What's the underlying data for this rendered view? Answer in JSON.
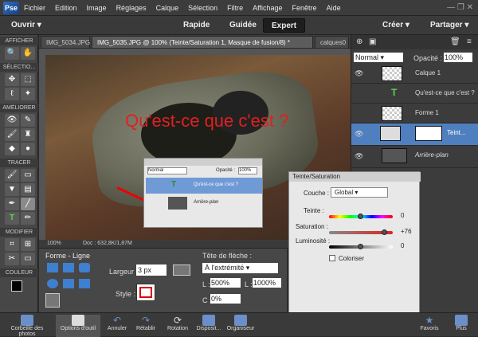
{
  "menubar": {
    "logo": "Pse",
    "items": [
      "Fichier",
      "Edition",
      "Image",
      "Réglages",
      "Calque",
      "Sélection",
      "Filtre",
      "Affichage",
      "Fenêtre",
      "Aide"
    ]
  },
  "modebar": {
    "open": "Ouvrir",
    "rapide": "Rapide",
    "guidee": "Guidée",
    "expert": "Expert",
    "creer": "Créer",
    "partager": "Partager"
  },
  "tools": {
    "afficher": "AFFICHER",
    "selection": "SÉLECTIO...",
    "ameliorer": "AMÉLIORER",
    "tracer": "TRACER",
    "modifier": "MODIFIER",
    "couleur": "COULEUR"
  },
  "tabs": [
    "IMG_5034.JPG",
    "IMG_5035.JPG @ 100% (Teinte/Saturation 1, Masque de fusion/8) *",
    "calques0"
  ],
  "canvas": {
    "bigtext": "Qu'est-ce que c'est ?"
  },
  "status": {
    "zoom": "100%",
    "doc": "Doc : 632,8K/1,87M"
  },
  "options": {
    "title": "Forme - Ligne",
    "largeur_label": "Largeur :",
    "largeur": "3 px",
    "style_label": "Style :",
    "tete_label": "Tête de flèche :",
    "tete": "À l'extrémité",
    "l_label": "L :",
    "l1": "500%",
    "l2_label": "L :",
    "l2": "1000%",
    "c_label": "C :",
    "c": "0%"
  },
  "bottom": [
    "Corbeille des photos",
    "Options d'outil",
    "Annuler",
    "Rétablir",
    "Rotation",
    "Disposit...",
    "Organiseur",
    "Favoris",
    "Plus"
  ],
  "layers": {
    "mode": "Normal",
    "opacity_label": "Opacité :",
    "opacity": "100%",
    "items": [
      {
        "name": "Calque 1"
      },
      {
        "name": "Qu'est-ce que c'est ?"
      },
      {
        "name": "Forme 1"
      },
      {
        "name": "Teint..."
      },
      {
        "name": "Arrière-plan"
      }
    ]
  },
  "mini": {
    "mode": "Normal",
    "opacity_label": "Opacité :",
    "opacity": "100%",
    "l1": "Qu'est-ce que c'est ?",
    "l2": "Arrière-plan"
  },
  "hs": {
    "title": "Teinte/Saturation",
    "couche_label": "Couche :",
    "couche": "Global",
    "teinte_label": "Teinte :",
    "teinte": "0",
    "teinte_pos": 0.5,
    "sat_label": "Saturation :",
    "sat": "+76",
    "sat_pos": 0.88,
    "lum_label": "Luminosité :",
    "lum": "0",
    "lum_pos": 0.5,
    "coloriser": "Coloriser"
  }
}
